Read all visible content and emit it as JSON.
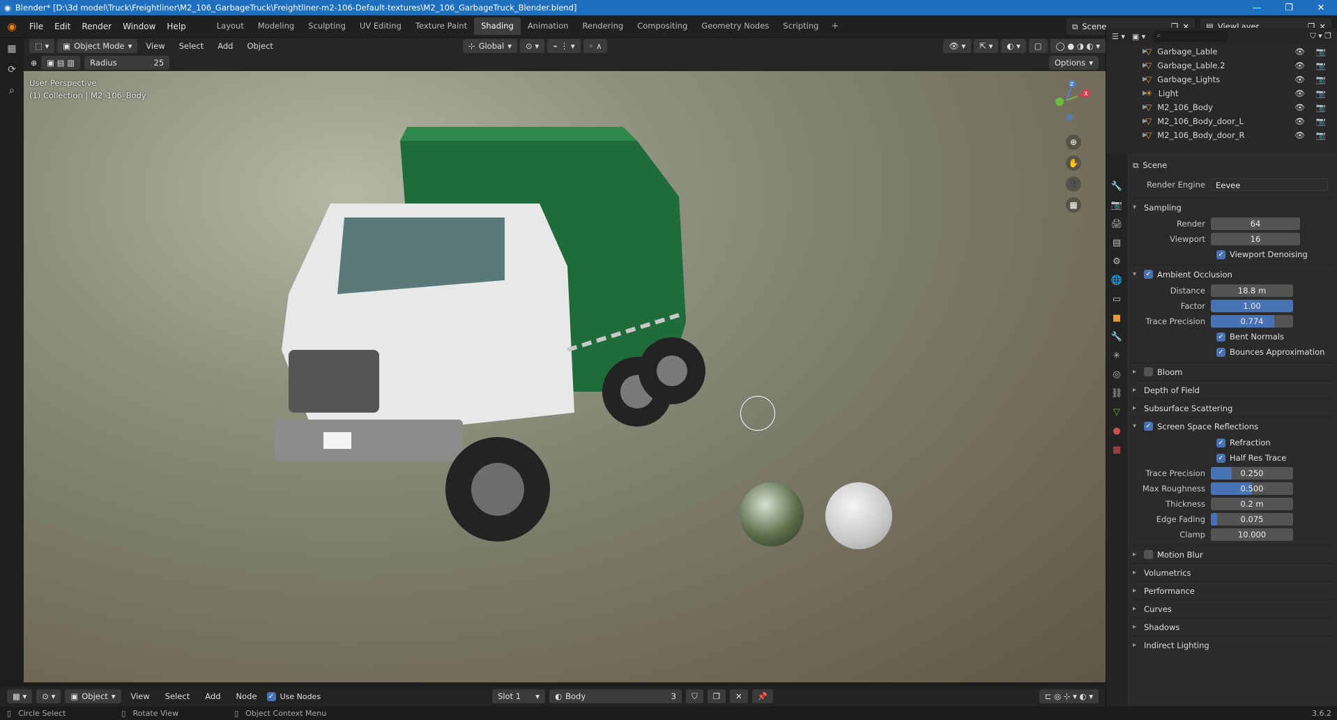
{
  "window": {
    "title": "Blender* [D:\\3d model\\Truck\\Freightliner\\M2_106_GarbageTruck\\Freightliner-m2-106-Default-textures\\M2_106_GarbageTruck_Blender.blend]"
  },
  "menu": [
    "File",
    "Edit",
    "Render",
    "Window",
    "Help"
  ],
  "workspaces": [
    "Layout",
    "Modeling",
    "Sculpting",
    "UV Editing",
    "Texture Paint",
    "Shading",
    "Animation",
    "Rendering",
    "Compositing",
    "Geometry Nodes",
    "Scripting"
  ],
  "active_workspace": "Shading",
  "scene": "Scene",
  "view_layer": "ViewLayer",
  "viewport_header": {
    "mode": "Object Mode",
    "view": "View",
    "select": "Select",
    "add": "Add",
    "object": "Object",
    "orientation": "Global",
    "options": "Options"
  },
  "tool": {
    "radius_label": "Radius",
    "radius_value": "25"
  },
  "viewport": {
    "perspective": "User Perspective",
    "collection": "(1) Collection | M2_106_Body"
  },
  "outliner": [
    {
      "name": "Garbage_Lable",
      "icon": "mesh-icon"
    },
    {
      "name": "Garbage_Lable.2",
      "icon": "mesh-icon"
    },
    {
      "name": "Garbage_Lights",
      "icon": "mesh-icon"
    },
    {
      "name": "Light",
      "icon": "light-icon"
    },
    {
      "name": "M2_106_Body",
      "icon": "mesh-icon"
    },
    {
      "name": "M2_106_Body_door_L",
      "icon": "mesh-icon"
    },
    {
      "name": "M2_106_Body_door_R",
      "icon": "mesh-icon"
    }
  ],
  "props": {
    "context": "Scene",
    "render_engine_label": "Render Engine",
    "render_engine": "Eevee",
    "sampling": {
      "title": "Sampling",
      "render_label": "Render",
      "render": "64",
      "viewport_label": "Viewport",
      "viewport": "16",
      "denoise": "Viewport Denoising"
    },
    "ao": {
      "title": "Ambient Occlusion",
      "distance_label": "Distance",
      "distance": "18.8 m",
      "factor_label": "Factor",
      "factor": "1.00",
      "factor_fill": 1.0,
      "trace_label": "Trace Precision",
      "trace": "0.774",
      "trace_fill": 0.774,
      "bent": "Bent Normals",
      "bounces": "Bounces Approximation"
    },
    "bloom": "Bloom",
    "dof": "Depth of Field",
    "sss": "Subsurface Scattering",
    "ssr": {
      "title": "Screen Space Reflections",
      "refraction": "Refraction",
      "half_res": "Half Res Trace",
      "trace_label": "Trace Precision",
      "trace": "0.250",
      "trace_fill": 0.25,
      "rough_label": "Max Roughness",
      "rough": "0.500",
      "rough_fill": 0.5,
      "thick_label": "Thickness",
      "thick": "0.2 m",
      "fade_label": "Edge Fading",
      "fade": "0.075",
      "fade_fill": 0.075,
      "clamp_label": "Clamp",
      "clamp": "10.000"
    },
    "collapsed": [
      "Motion Blur",
      "Volumetrics",
      "Performance",
      "Curves",
      "Shadows",
      "Indirect Lighting"
    ]
  },
  "node_header": {
    "object": "Object",
    "view": "View",
    "select": "Select",
    "add": "Add",
    "node": "Node",
    "use_nodes": "Use Nodes",
    "slot": "Slot 1",
    "material": "Body",
    "users": "3"
  },
  "status": {
    "left": "Circle Select",
    "mid": "Rotate View",
    "right": "Object Context Menu",
    "version": "3.6.2"
  }
}
